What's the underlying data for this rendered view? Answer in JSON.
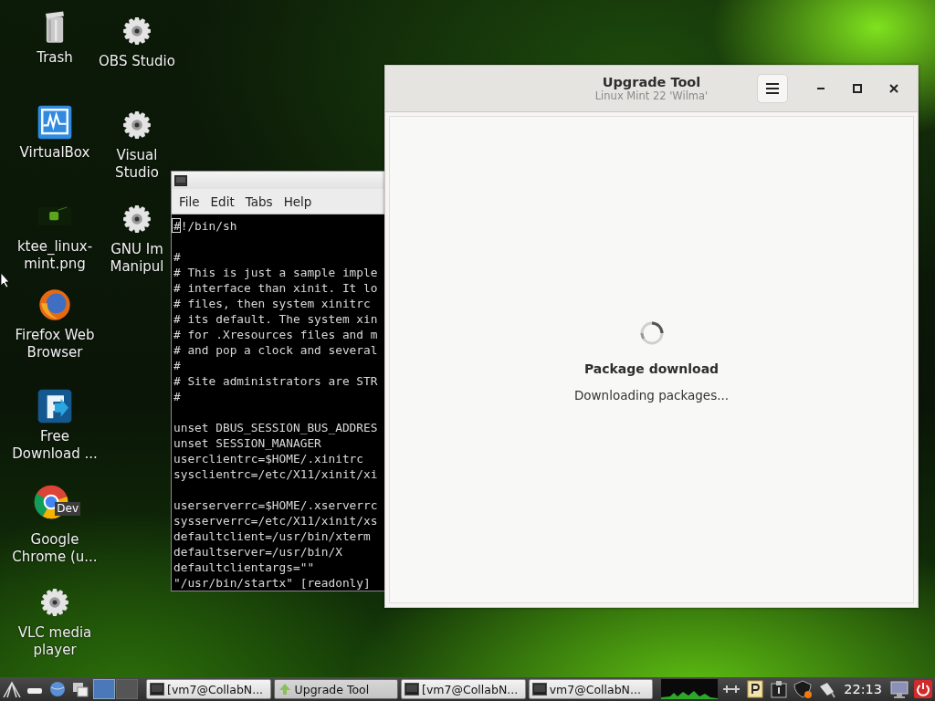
{
  "desktop_icons": [
    {
      "kind": "trash",
      "label": [
        "Trash"
      ]
    },
    {
      "kind": "virtualbox",
      "label": [
        "VirtualBox"
      ]
    },
    {
      "kind": "image",
      "label": [
        "ktee_linux-",
        "mint.png"
      ]
    },
    {
      "kind": "firefox",
      "label": [
        "Firefox Web",
        "Browser"
      ]
    },
    {
      "kind": "download",
      "label": [
        "Free",
        "Download ..."
      ]
    },
    {
      "kind": "chrome",
      "label": [
        "Google",
        "Chrome (u..."
      ],
      "badge": "Dev"
    },
    {
      "kind": "gear",
      "label": [
        "VLC media",
        "player"
      ]
    },
    {
      "kind": "gear",
      "label": [
        "OBS Studio"
      ]
    },
    {
      "kind": "gear",
      "label": [
        "Visual",
        "Studio"
      ]
    },
    {
      "kind": "gear",
      "label": [
        "GNU Im",
        "Manipul"
      ]
    }
  ],
  "terminal": {
    "menu": [
      "File",
      "Edit",
      "Tabs",
      "Help"
    ],
    "lines": [
      {
        "kind": "text",
        "text": "#!/bin/sh",
        "cursor": true
      },
      {
        "kind": "blank"
      },
      {
        "kind": "text",
        "text": "#"
      },
      {
        "kind": "text",
        "text": "# This is just a sample imple"
      },
      {
        "kind": "text",
        "text": "# interface than xinit. It lo"
      },
      {
        "kind": "text",
        "text": "# files, then system xinitrc"
      },
      {
        "kind": "text",
        "text": "# its default. The system xin"
      },
      {
        "kind": "text",
        "text": "# for .Xresources files and m"
      },
      {
        "kind": "text",
        "text": "# and pop a clock and several"
      },
      {
        "kind": "text",
        "text": "#"
      },
      {
        "kind": "text",
        "text": "# Site administrators are STR"
      },
      {
        "kind": "text",
        "text": "#"
      },
      {
        "kind": "blank"
      },
      {
        "kind": "text",
        "text": "unset DBUS_SESSION_BUS_ADDRES"
      },
      {
        "kind": "text",
        "text": "unset SESSION_MANAGER"
      },
      {
        "kind": "text",
        "text": "userclientrc=$HOME/.xinitrc"
      },
      {
        "kind": "text",
        "text": "sysclientrc=/etc/X11/xinit/xi"
      },
      {
        "kind": "blank"
      },
      {
        "kind": "text",
        "text": "userserverrc=$HOME/.xserverrc"
      },
      {
        "kind": "text",
        "text": "sysserverrc=/etc/X11/xinit/xs"
      },
      {
        "kind": "text",
        "text": "defaultclient=/usr/bin/xterm"
      },
      {
        "kind": "text",
        "text": "defaultserver=/usr/bin/X"
      },
      {
        "kind": "text",
        "text": "defaultclientargs=\"\""
      },
      {
        "kind": "text",
        "text": "\"/usr/bin/startx\" [readonly]"
      }
    ]
  },
  "upgrade_window": {
    "title": "Upgrade Tool",
    "subtitle": "Linux Mint 22 'Wilma'",
    "heading": "Package download",
    "status": "Downloading packages..."
  },
  "taskbar": {
    "workspaces": [
      {
        "selected": true
      },
      {
        "selected": false
      }
    ],
    "tasks": [
      {
        "kind": "terminal",
        "label": "[vm7@CollabN...",
        "selected": false
      },
      {
        "kind": "upgrade",
        "label": "Upgrade Tool",
        "selected": true
      },
      {
        "kind": "terminal",
        "label": "[vm7@CollabN...",
        "selected": false
      },
      {
        "kind": "terminal",
        "label": "vm7@CollabN...",
        "selected": false
      }
    ],
    "clock": "22:13"
  }
}
